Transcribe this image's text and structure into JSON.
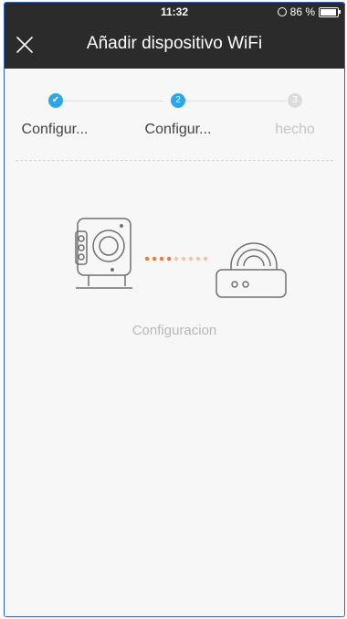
{
  "status_bar": {
    "time": "11:32",
    "battery": "86 %",
    "alarm_icon": "alarm-clock-icon",
    "battery_icon": "battery-icon"
  },
  "header": {
    "title": "Añadir dispositivo WiFi",
    "close_icon": "close-icon"
  },
  "steps": [
    {
      "label": "Configur...",
      "state": "done",
      "marker": "✔"
    },
    {
      "label": "Configur...",
      "state": "active",
      "marker": "2"
    },
    {
      "label": "hecho",
      "state": "inactive",
      "marker": "3"
    }
  ],
  "illustration": {
    "camera_icon": "camera-icon",
    "router_icon": "wifi-router-icon",
    "progress_dots": 7,
    "caption": "Configuracion"
  },
  "colors": {
    "accent": "#2aa7ea",
    "header_bg": "#2b2b2b",
    "dot_active": "#f07a2c",
    "dot_inactive": "#f7c2a0"
  }
}
